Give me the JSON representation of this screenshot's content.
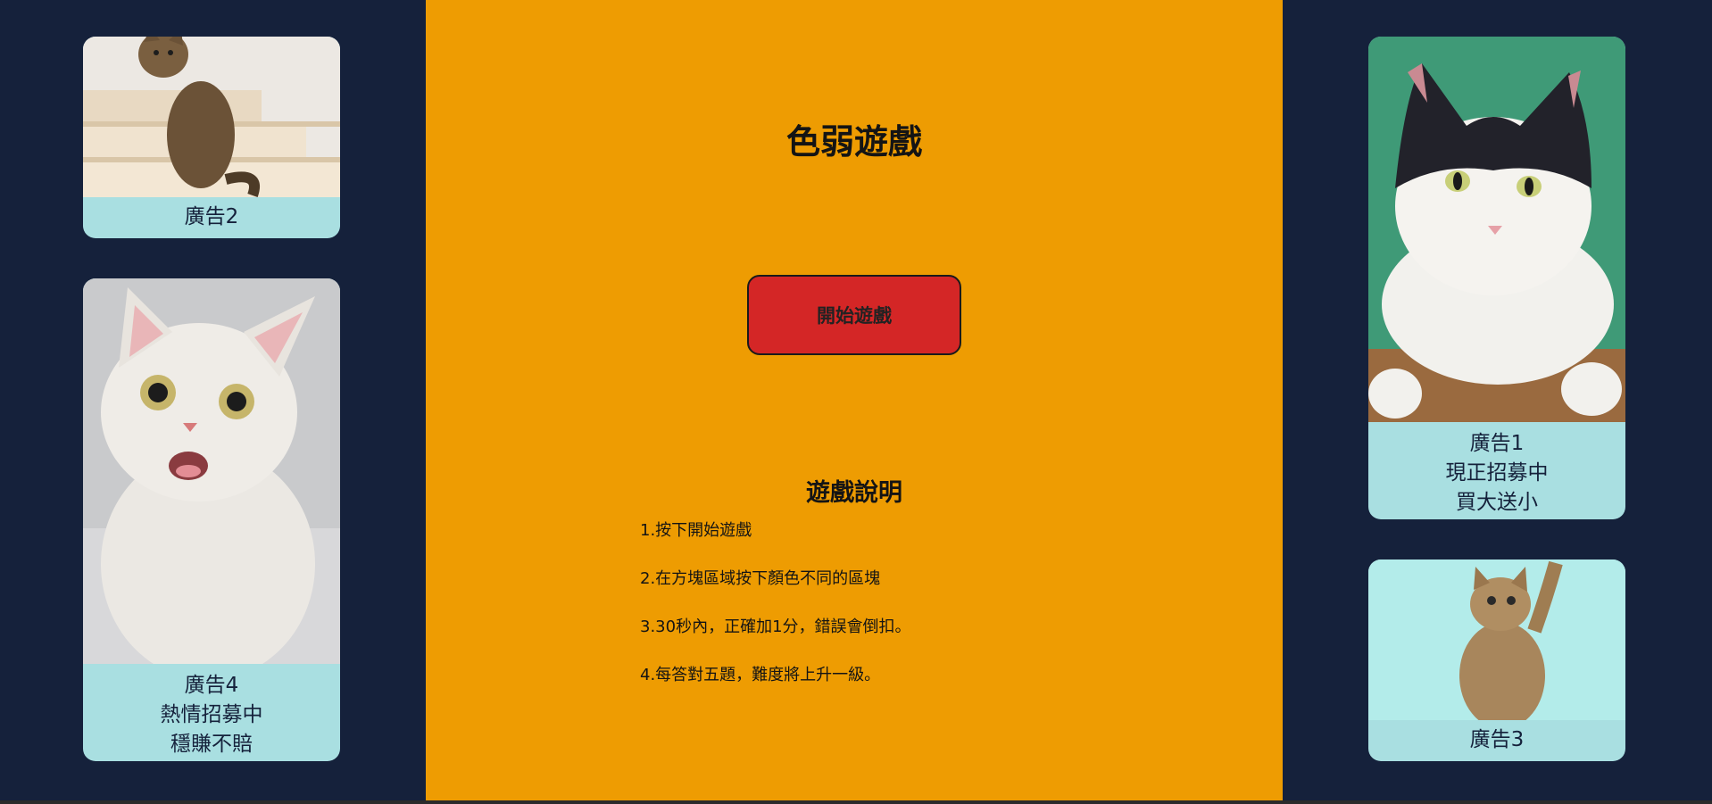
{
  "game": {
    "title": "色弱遊戲",
    "start_button": "開始遊戲",
    "rules_heading": "遊戲說明",
    "rules": [
      "1.按下開始遊戲",
      "2.在方塊區域按下顏色不同的區塊",
      "3.30秒內，正確加1分，錯誤會倒扣。",
      "4.每答對五題，難度將上升一級。"
    ]
  },
  "ads": {
    "ad2": {
      "lines": [
        "廣告2"
      ]
    },
    "ad4": {
      "lines": [
        "廣告4",
        "熱情招募中",
        "穩賺不賠"
      ]
    },
    "ad1": {
      "lines": [
        "廣告1",
        "現正招募中",
        "買大送小"
      ]
    },
    "ad3": {
      "lines": [
        "廣告3"
      ]
    }
  },
  "colors": {
    "background": "#15213b",
    "main_panel": "#ee9c02",
    "start_button": "#d42626",
    "ad_card": "#a9dfe1"
  }
}
